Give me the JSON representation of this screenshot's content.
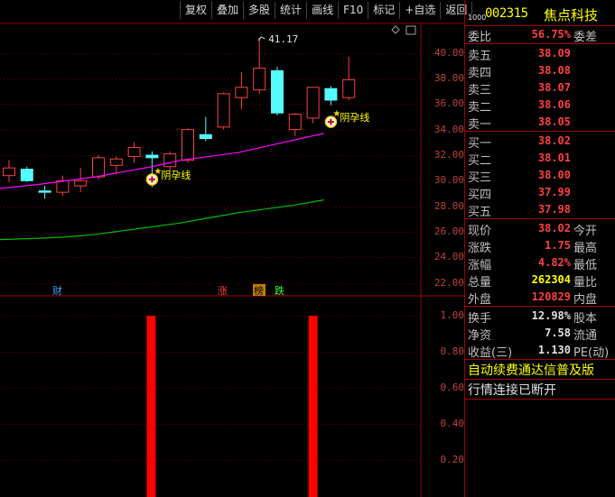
{
  "toolbar": {
    "buttons": [
      "复权",
      "叠加",
      "多股",
      "统计",
      "画线",
      "F10",
      "标记",
      "+自选",
      "返回"
    ]
  },
  "stock": {
    "market_code": "1000",
    "code": "002315",
    "name": "焦点科技"
  },
  "chart": {
    "price_ticks": [
      "40.00",
      "38.00",
      "36.00",
      "34.00",
      "32.00",
      "30.00",
      "28.00",
      "26.00",
      "24.00",
      "22.00"
    ],
    "indicator_ticks": [
      "1.00",
      "0.80",
      "0.60",
      "0.40",
      "0.20"
    ],
    "high_label": "41.17",
    "pattern_labels": [
      "阴孕线",
      "阴孕线"
    ],
    "event_markers": [
      "财",
      "涨",
      "榜",
      "跌"
    ],
    "colors": {
      "up": "#ff4040",
      "down": "#54fcfc",
      "ma_short": "#ff00ff",
      "ma_long": "#00c000",
      "bar": "#ff0000"
    }
  },
  "chart_data": {
    "type": "candlestick",
    "ylim": [
      21,
      43
    ],
    "candles": [
      {
        "o": 30.4,
        "h": 31.6,
        "l": 29.9,
        "c": 31.0
      },
      {
        "o": 30.9,
        "h": 31.1,
        "l": 29.9,
        "c": 30.0
      },
      {
        "o": 29.2,
        "h": 29.6,
        "l": 28.6,
        "c": 29.1
      },
      {
        "o": 29.1,
        "h": 30.4,
        "l": 28.8,
        "c": 30.0
      },
      {
        "o": 29.6,
        "h": 31.0,
        "l": 29.1,
        "c": 30.0
      },
      {
        "o": 30.3,
        "h": 32.0,
        "l": 30.1,
        "c": 31.8
      },
      {
        "o": 31.2,
        "h": 31.9,
        "l": 30.5,
        "c": 31.7
      },
      {
        "o": 31.9,
        "h": 33.0,
        "l": 31.4,
        "c": 32.6
      },
      {
        "o": 32.0,
        "h": 32.3,
        "l": 29.5,
        "c": 31.8
      },
      {
        "o": 31.1,
        "h": 32.3,
        "l": 30.7,
        "c": 32.1
      },
      {
        "o": 31.6,
        "h": 34.1,
        "l": 31.4,
        "c": 34.0
      },
      {
        "o": 33.6,
        "h": 35.0,
        "l": 33.1,
        "c": 33.3
      },
      {
        "o": 34.2,
        "h": 36.9,
        "l": 34.0,
        "c": 36.8
      },
      {
        "o": 36.5,
        "h": 38.5,
        "l": 35.6,
        "c": 37.3
      },
      {
        "o": 37.1,
        "h": 41.17,
        "l": 36.8,
        "c": 38.8
      },
      {
        "o": 38.6,
        "h": 38.9,
        "l": 35.1,
        "c": 35.3
      },
      {
        "o": 34.0,
        "h": 35.3,
        "l": 33.5,
        "c": 35.2
      },
      {
        "o": 34.9,
        "h": 37.3,
        "l": 34.5,
        "c": 37.3
      },
      {
        "o": 37.2,
        "h": 37.4,
        "l": 35.9,
        "c": 36.3
      },
      {
        "o": 36.5,
        "h": 39.7,
        "l": 36.3,
        "c": 37.9
      }
    ],
    "ma_short": [
      29.4,
      29.7,
      30.0,
      30.3,
      30.7,
      31.1,
      31.6,
      31.9,
      32.2,
      32.7,
      33.2,
      33.7
    ],
    "ma_long": [
      25.4,
      25.5,
      25.6,
      25.8,
      26.1,
      26.4,
      26.7,
      27.1,
      27.5,
      27.8,
      28.1,
      28.5
    ],
    "indicator": [
      0,
      0,
      0,
      0,
      0,
      0,
      0,
      0,
      1,
      0,
      0,
      0,
      0,
      0,
      0,
      0,
      0,
      1,
      0,
      0
    ]
  },
  "quote": {
    "weibi_label": "委比",
    "weibi_value": "56.75%",
    "weicha_label": "委差",
    "sells": [
      {
        "label": "卖五",
        "price": "38.09"
      },
      {
        "label": "卖四",
        "price": "38.08"
      },
      {
        "label": "卖三",
        "price": "38.07"
      },
      {
        "label": "卖二",
        "price": "38.06"
      },
      {
        "label": "卖一",
        "price": "38.05"
      }
    ],
    "buys": [
      {
        "label": "买一",
        "price": "38.02"
      },
      {
        "label": "买二",
        "price": "38.01"
      },
      {
        "label": "买三",
        "price": "38.00"
      },
      {
        "label": "买四",
        "price": "37.99"
      },
      {
        "label": "买五",
        "price": "37.98"
      }
    ],
    "stats1": [
      {
        "label": "现价",
        "value": "38.02",
        "label2": "今开",
        "color": "#ff4040"
      },
      {
        "label": "涨跌",
        "value": "1.75",
        "label2": "最高",
        "color": "#ff4040"
      },
      {
        "label": "涨幅",
        "value": "4.82%",
        "label2": "最低",
        "color": "#ff4040"
      },
      {
        "label": "总量",
        "value": "262304",
        "label2": "量比",
        "color": "#ffff00"
      },
      {
        "label": "外盘",
        "value": "120829",
        "label2": "内盘",
        "color": "#ff4040"
      }
    ],
    "stats2": [
      {
        "label": "换手",
        "value": "12.98%",
        "label2": "股本"
      },
      {
        "label": "净资",
        "value": "7.58",
        "label2": "流通"
      },
      {
        "label": "收益(三)",
        "value": "1.130",
        "label2": "PE(动)"
      }
    ],
    "notice1": "自动续费通达信普及版",
    "notice2": "行情连接已断开"
  }
}
